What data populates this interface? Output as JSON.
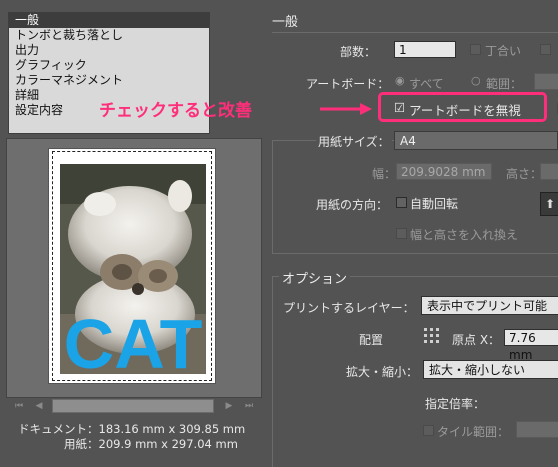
{
  "categories": {
    "items": [
      "一般",
      "トンボと裁ち落とし",
      "出力",
      "グラフィック",
      "カラーマネジメント",
      "詳細",
      "設定内容"
    ],
    "selected_index": 0
  },
  "document_info": {
    "document": "ドキュメント：183.16 mm x 309.85 mm",
    "paper": "用紙：209.9 mm x 297.04 mm"
  },
  "preview": {
    "cat_text": "CAT"
  },
  "general": {
    "header": "一般",
    "copies_label": "部数：",
    "copies_value": "1",
    "collate_label": "丁合い",
    "artboard_label": "アートボード：",
    "artboard_all_label": "すべて",
    "artboard_range_label": "範囲：",
    "ignore_artboard_label": "アートボードを無視",
    "callout_text": "チェックすると改善"
  },
  "paper": {
    "size_label": "用紙サイズ：",
    "size_value": "A4",
    "width_label": "幅：",
    "width_value": "209.9028 mm",
    "height_label": "高さ：",
    "orientation_label": "用紙の方向：",
    "auto_rotate_label": "自動回転",
    "swap_label": "幅と高さを入れ換え"
  },
  "options": {
    "header": "オプション",
    "print_layers_label": "プリントするレイヤー：",
    "print_layers_value": "表示中でプリント可能",
    "placement_label": "配置",
    "origin_x_label": "原点 X：",
    "origin_x_value": "7.76 mm",
    "scale_label": "拡大・縮小：",
    "scale_value": "拡大・縮小しない",
    "scale_factor_label": "指定倍率：",
    "tile_range_label": "タイル範囲："
  },
  "colors": {
    "callout": "#ff2e7a",
    "panel_bg": "#535353"
  }
}
